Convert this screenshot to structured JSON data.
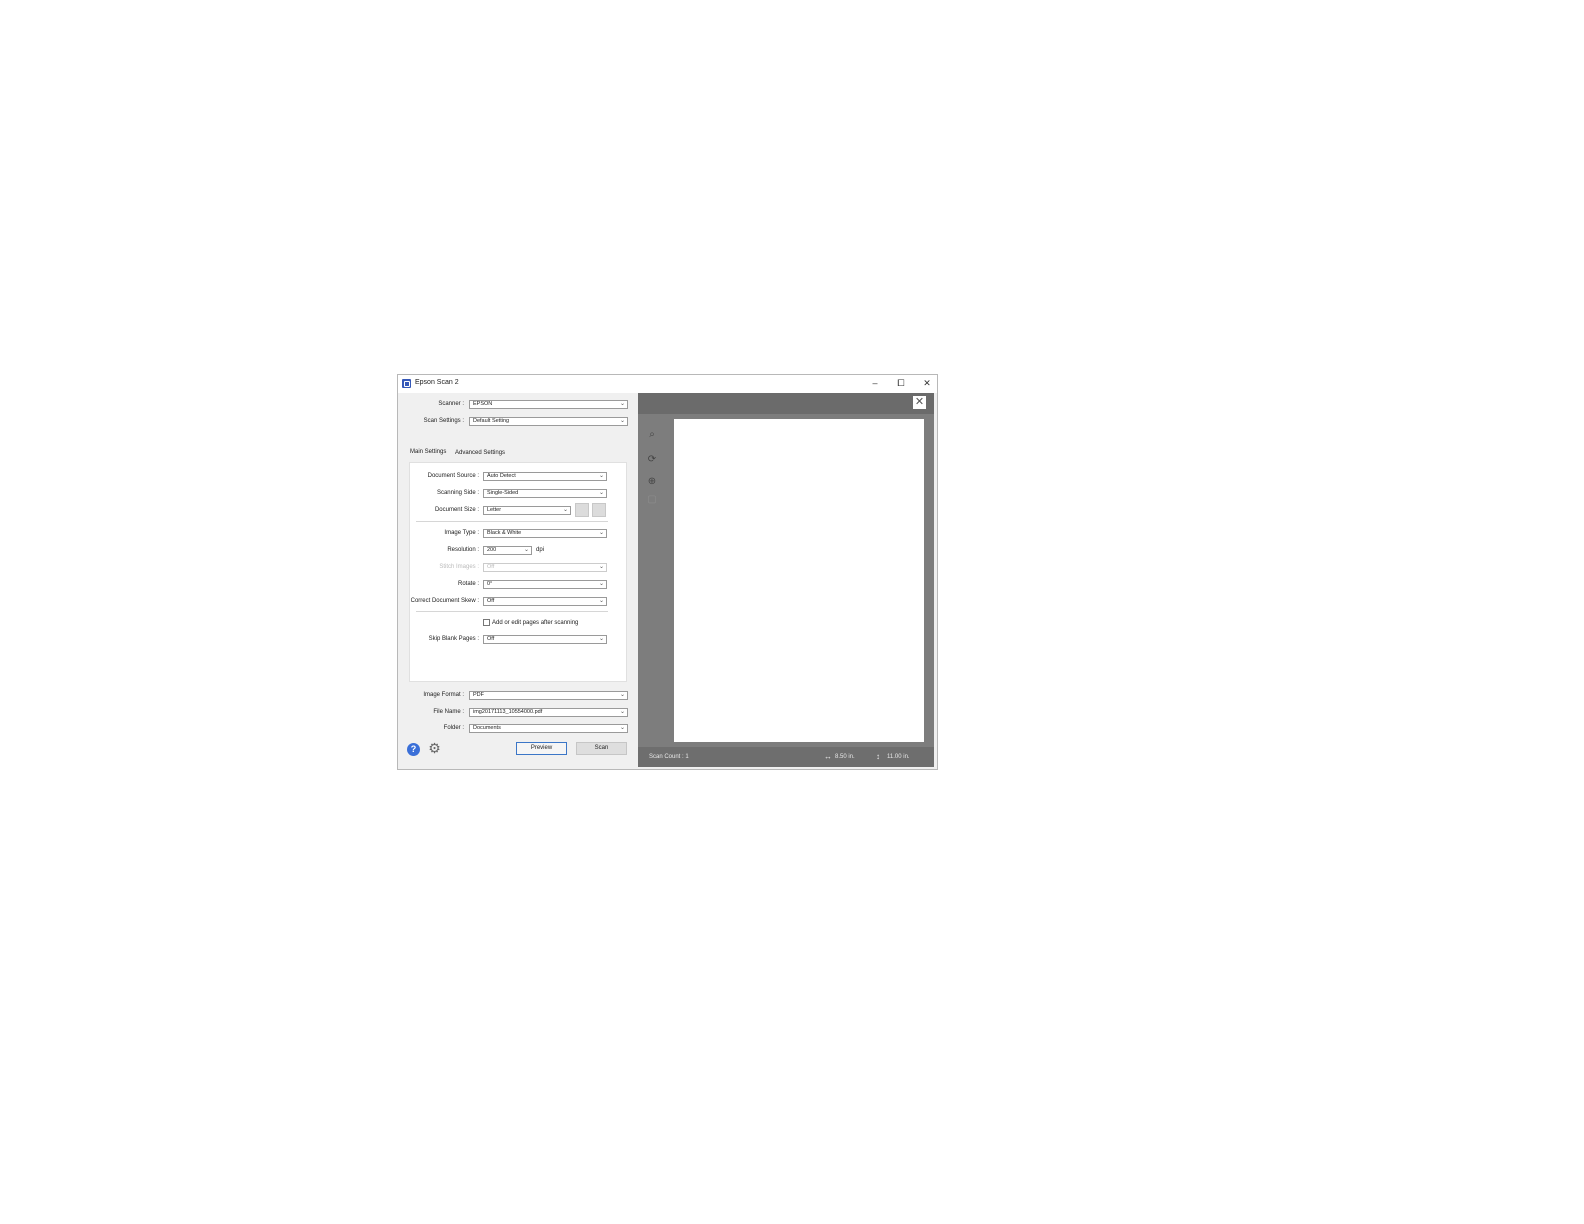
{
  "window": {
    "title": "Epson Scan 2"
  },
  "top": {
    "scanner_label": "Scanner :",
    "scanner_value": "EPSON",
    "scan_settings_label": "Scan Settings :",
    "scan_settings_value": "Default Setting"
  },
  "tabs": {
    "main": "Main Settings",
    "advanced": "Advanced Settings"
  },
  "main": {
    "document_source_label": "Document Source :",
    "document_source_value": "Auto Detect",
    "scanning_side_label": "Scanning Side :",
    "scanning_side_value": "Single-Sided",
    "document_size_label": "Document Size :",
    "document_size_value": "Letter",
    "image_type_label": "Image Type :",
    "image_type_value": "Black & White",
    "resolution_label": "Resolution :",
    "resolution_value": "200",
    "resolution_unit": "dpi",
    "stitch_label": "Stitch Images :",
    "stitch_value": "Off",
    "rotate_label": "Rotate :",
    "rotate_value": "0°",
    "skew_label": "Correct Document Skew :",
    "skew_value": "Off",
    "add_pages_label": "Add or edit pages after scanning",
    "skip_blank_label": "Skip Blank Pages :",
    "skip_blank_value": "Off"
  },
  "output": {
    "image_format_label": "Image Format :",
    "image_format_value": "PDF",
    "file_name_label": "File Name :",
    "file_name_value": "img20171113_10554000.pdf",
    "folder_label": "Folder :",
    "folder_value": "Documents"
  },
  "buttons": {
    "preview": "Preview",
    "scan": "Scan"
  },
  "preview_panel": {
    "scan_count": "Scan Count : 1",
    "width": "8.50 in.",
    "height": "11.00 in."
  }
}
